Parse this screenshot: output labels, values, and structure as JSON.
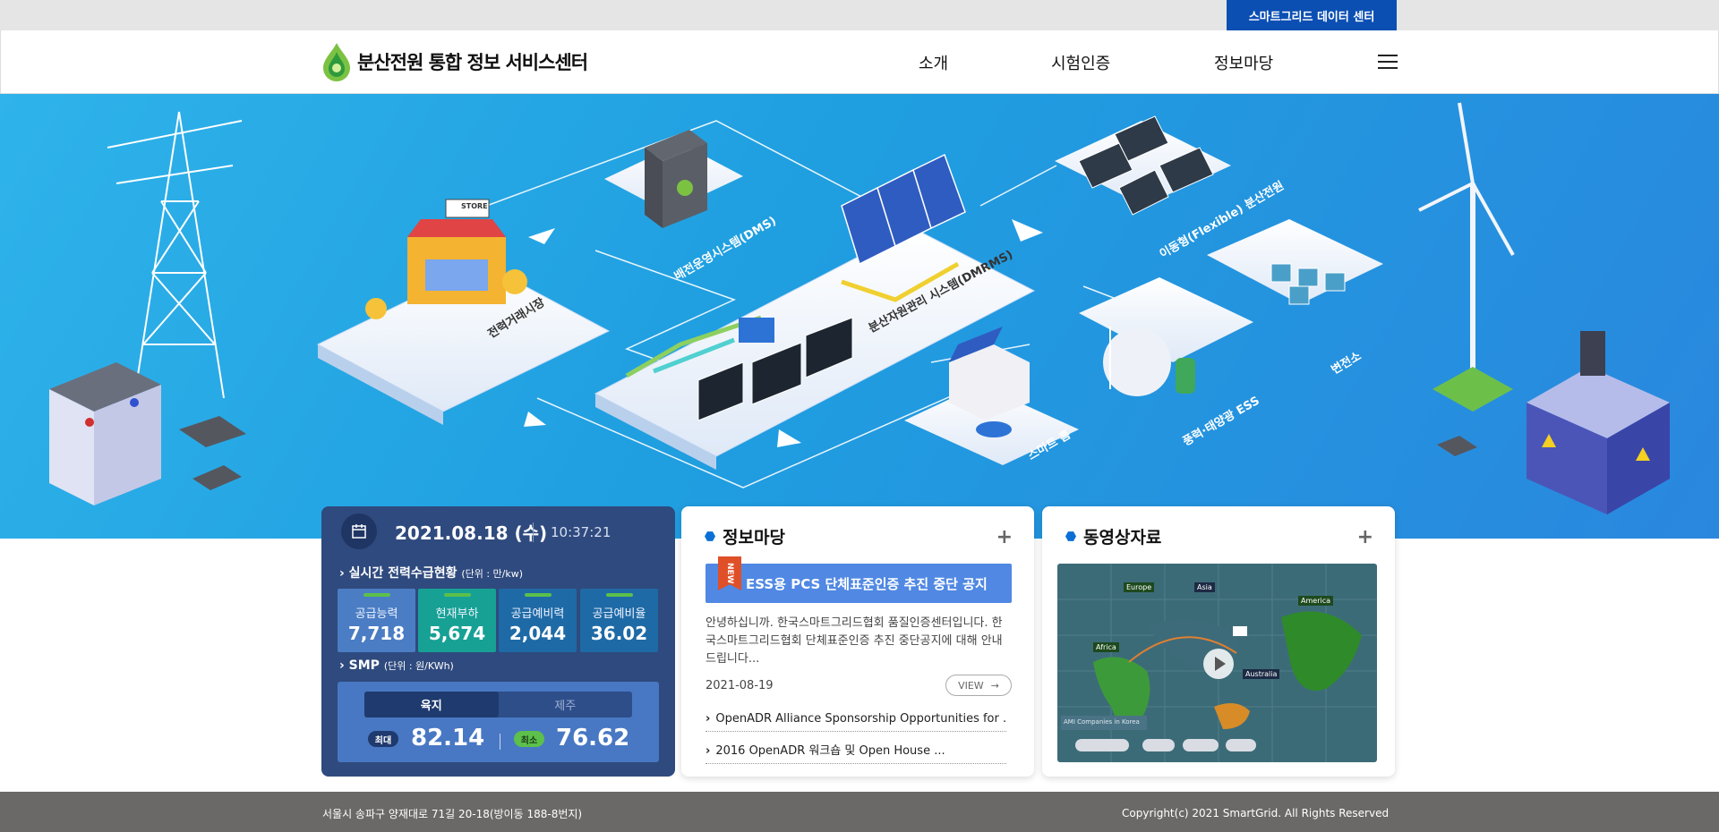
{
  "topbar": {
    "data_center_label": "스마트그리드 데이터 센터"
  },
  "header": {
    "logo_title": "분산전원 통합 정보 서비스센터",
    "nav": [
      "소개",
      "시험인증",
      "정보마당"
    ]
  },
  "hero": {
    "labels": {
      "power_market": "전력거래시장",
      "dms": "배전운영시스템(DMS)",
      "dmrms": "분산자원관리 시스템(DMRMS)",
      "flexible": "이동형(Flexible) 분산전원",
      "substation": "변전소",
      "smart_home": "스마트 홈",
      "wind_solar_ess": "풍력·태양광 ESS",
      "store": "STORE"
    }
  },
  "power": {
    "date": "2021.08.18 (수)",
    "time": "10:37:21",
    "realtime_title": "실시간 전력수급현황",
    "realtime_unit": "(단위 : 만/kw)",
    "stats": [
      {
        "label": "공급능력",
        "value": "7,718"
      },
      {
        "label": "현재부하",
        "value": "5,674"
      },
      {
        "label": "공급예비력",
        "value": "2,044"
      },
      {
        "label": "공급예비율",
        "value": "36.02"
      }
    ],
    "smp_title": "SMP",
    "smp_unit": "(단위 : 원/KWh)",
    "smp_tabs": [
      "육지",
      "제주"
    ],
    "max_label": "최대",
    "max_value": "82.14",
    "min_label": "최소",
    "min_value": "76.62"
  },
  "info": {
    "title": "정보마당",
    "new_tag": "NEW",
    "notice_title": "ESS용 PCS 단체표준인증 추진 중단 공지",
    "notice_body": "안녕하십니까. 한국스마트그리드협회 품질인증센터입니다. 한국스마트그리드협회 단체표준인증 추진 중단공지에 대해 안내드립니다...",
    "notice_date": "2021-08-19",
    "view_label": "VIEW",
    "news": [
      "OpenADR Alliance Sponsorship Opportunities for ...",
      "2016 OpenADR 워크숍 및 Open House ..."
    ]
  },
  "video": {
    "title": "동영상자료",
    "map_regions": [
      "Europe",
      "Asia",
      "America",
      "Africa",
      "Australia"
    ],
    "map_caption": "AMI Companies in Korea"
  },
  "footer": {
    "address": "서울시 송파구 양재대로 71길 20-18(방이동 188-8번지)",
    "copyright": "Copyright(c) 2021 SmartGrid. All Rights Reserved"
  }
}
